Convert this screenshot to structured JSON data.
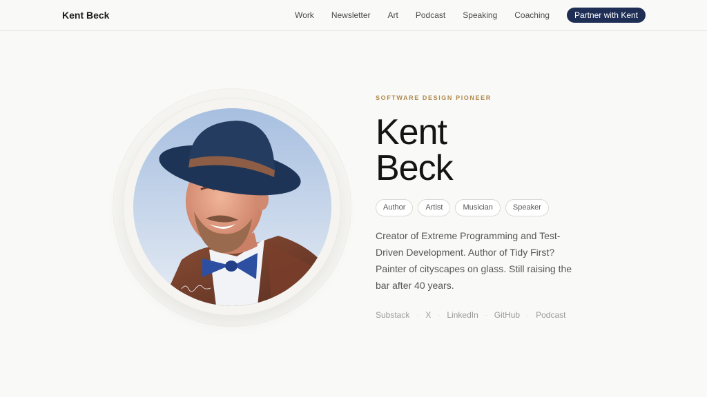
{
  "header": {
    "brand": "Kent Beck",
    "nav": [
      "Work",
      "Newsletter",
      "Art",
      "Podcast",
      "Speaking",
      "Coaching"
    ],
    "cta": "Partner with Kent"
  },
  "hero": {
    "eyebrow": "SOFTWARE DESIGN PIONEER",
    "name_line1": "Kent",
    "name_line2": "Beck",
    "tags": [
      "Author",
      "Artist",
      "Musician",
      "Speaker"
    ],
    "bio": "Creator of Extreme Programming and Test-Driven Development. Author of Tidy First? Painter of cityscapes on glass. Still raising the bar after 40 years.",
    "social": [
      "Substack",
      "X",
      "LinkedIn",
      "GitHub",
      "Podcast"
    ],
    "social_separator": "·"
  },
  "colors": {
    "accent_navy": "#1e2e55",
    "eyebrow_gold": "#b08a4e",
    "background": "#f9f9f7"
  },
  "icons": {
    "portrait": "kent-beck-portrait"
  }
}
